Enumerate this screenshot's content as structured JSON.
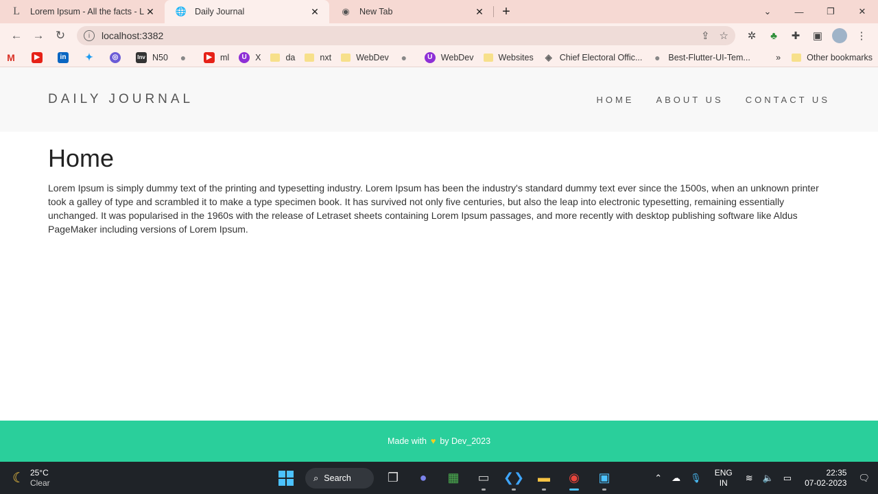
{
  "browser": {
    "tabs": [
      {
        "title": "Lorem Ipsum - All the facts - Lipsum",
        "favicon": "L",
        "active": false
      },
      {
        "title": "Daily Journal",
        "favicon": "globe-icon",
        "active": true
      },
      {
        "title": "New Tab",
        "favicon": "chrome-icon",
        "active": false
      }
    ],
    "address": "localhost:3382",
    "bookmarks": [
      "N50",
      "ml",
      "X",
      "da",
      "nxt",
      "WebDev",
      "WebDev",
      "Websites",
      "Chief Electoral Offic...",
      "Best-Flutter-UI-Tem..."
    ],
    "bookmarks_more": "»",
    "other_bookmarks": "Other bookmarks"
  },
  "site": {
    "brand": "DAILY JOURNAL",
    "nav": [
      "HOME",
      "ABOUT US",
      "CONTACT US"
    ],
    "heading": "Home",
    "body": "Lorem Ipsum is simply dummy text of the printing and typesetting industry. Lorem Ipsum has been the industry's standard dummy text ever since the 1500s, when an unknown printer took a galley of type and scrambled it to make a type specimen book. It has survived not only five centuries, but also the leap into electronic typesetting, remaining essentially unchanged. It was popularised in the 1960s with the release of Letraset sheets containing Lorem Ipsum passages, and more recently with desktop publishing software like Aldus PageMaker including versions of Lorem Ipsum.",
    "footer_prefix": "Made with",
    "footer_suffix": "by Dev_2023",
    "footer_color": "#2acf9b"
  },
  "taskbar": {
    "temp": "25°C",
    "weather": "Clear",
    "search": "Search",
    "lang1": "ENG",
    "lang2": "IN",
    "time": "22:35",
    "date": "07-02-2023"
  }
}
